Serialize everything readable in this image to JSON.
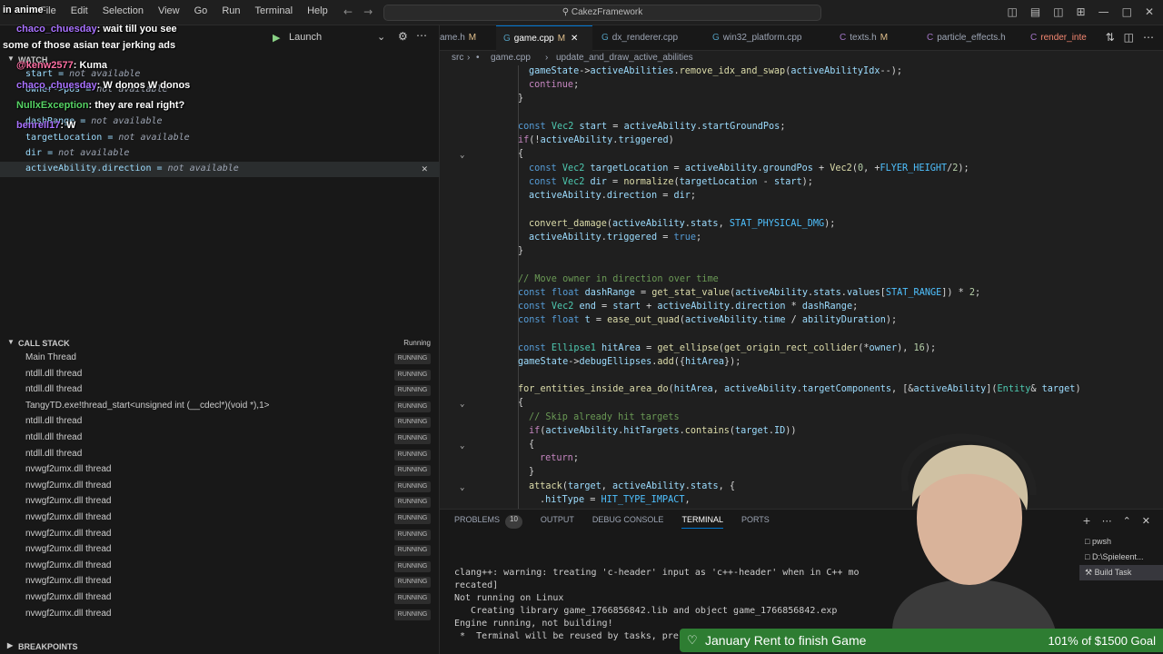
{
  "titlebar": {
    "menu": [
      "File",
      "Edit",
      "Selection",
      "View",
      "Go",
      "Run",
      "Terminal",
      "Help"
    ],
    "command_center": "CakezFramework"
  },
  "debug": {
    "launch_config": "Launch",
    "watch_label": "WATCH",
    "watch": [
      {
        "expr": "start",
        "value": "not available"
      },
      {
        "expr": "owner->pos",
        "value": "not available"
      },
      {
        "expr": "dashRange",
        "value": "not available"
      },
      {
        "expr": "targetLocation",
        "value": "not available"
      },
      {
        "expr": "dir",
        "value": "not available"
      },
      {
        "expr": "activeAbility.direction",
        "value": "not available"
      }
    ],
    "callstack_label": "CALL STACK",
    "callstack_status": "Running",
    "threads": [
      {
        "name": "Main Thread",
        "state": "RUNNING"
      },
      {
        "name": "ntdll.dll thread",
        "state": "RUNNING"
      },
      {
        "name": "ntdll.dll thread",
        "state": "RUNNING"
      },
      {
        "name": "TangyTD.exe!thread_start<unsigned int (__cdecl*)(void *),1>",
        "state": "RUNNING"
      },
      {
        "name": "ntdll.dll thread",
        "state": "RUNNING"
      },
      {
        "name": "ntdll.dll thread",
        "state": "RUNNING"
      },
      {
        "name": "ntdll.dll thread",
        "state": "RUNNING"
      },
      {
        "name": "nvwgf2umx.dll thread",
        "state": "RUNNING"
      },
      {
        "name": "nvwgf2umx.dll thread",
        "state": "RUNNING"
      },
      {
        "name": "nvwgf2umx.dll thread",
        "state": "RUNNING"
      },
      {
        "name": "nvwgf2umx.dll thread",
        "state": "RUNNING"
      },
      {
        "name": "nvwgf2umx.dll thread",
        "state": "RUNNING"
      },
      {
        "name": "nvwgf2umx.dll thread",
        "state": "RUNNING"
      },
      {
        "name": "nvwgf2umx.dll thread",
        "state": "RUNNING"
      },
      {
        "name": "nvwgf2umx.dll thread",
        "state": "RUNNING"
      },
      {
        "name": "nvwgf2umx.dll thread",
        "state": "RUNNING"
      },
      {
        "name": "nvwgf2umx.dll thread",
        "state": "RUNNING"
      }
    ],
    "breakpoints_label": "BREAKPOINTS"
  },
  "chat": [
    {
      "user": "",
      "text": "in anime"
    },
    {
      "user": "chaco_chuesday",
      "text": ": wait till you see"
    },
    {
      "user": "",
      "text": "some of those asian tear jerking ads"
    },
    {
      "user": "@kenw2577",
      "text": ": Kuma"
    },
    {
      "user": "chaco_chuesday",
      "text": ": W donos W donos"
    },
    {
      "user": "NullxException",
      "text": ": they are real right?"
    },
    {
      "user": "benrell17",
      "text": ": W"
    }
  ],
  "tabs": [
    {
      "label": "ame.h",
      "mod": "M",
      "icon": "h"
    },
    {
      "label": "game.cpp",
      "mod": "M",
      "icon": "cpp",
      "active": true
    },
    {
      "label": "dx_renderer.cpp",
      "mod": "",
      "icon": "cpp"
    },
    {
      "label": "win32_platform.cpp",
      "mod": "",
      "icon": "cpp"
    },
    {
      "label": "texts.h",
      "mod": "M",
      "icon": "h"
    },
    {
      "label": "particle_effects.h",
      "mod": "",
      "icon": "h"
    },
    {
      "label": "render_inte",
      "mod": "",
      "icon": "h"
    }
  ],
  "breadcrumb": [
    "src",
    "game.cpp",
    "update_and_draw_active_abilities"
  ],
  "panel": {
    "tabs": [
      "PROBLEMS",
      "OUTPUT",
      "DEBUG CONSOLE",
      "TERMINAL",
      "PORTS"
    ],
    "problems_count": "10",
    "terminal_lines": [
      "clang++: warning: treating 'c-header' input as 'c++-header' when in C++ mo",
      "recated]",
      "Not running on Linux",
      "   Creating library game_1766856842.lib and object game_1766856842.exp",
      "Engine running, not building!",
      " *  Terminal will be reused by tasks, pre"
    ],
    "terminals": [
      "pwsh",
      "D:\\Spieleent...",
      "Build Task"
    ]
  },
  "goal": {
    "title": "January Rent to finish Game",
    "amount": "101% of $1500 Goal"
  },
  "colors": {
    "accent": "#0078d4",
    "goal_bg": "#2e7d32"
  }
}
